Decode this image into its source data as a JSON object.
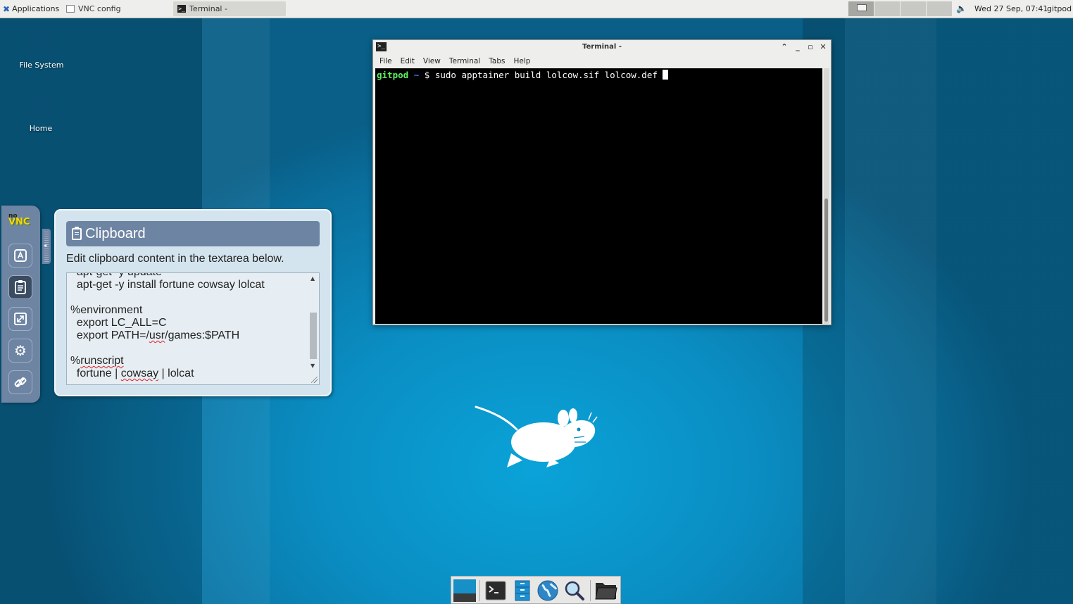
{
  "top_panel": {
    "applications_label": "Applications",
    "tasks": [
      {
        "label": "VNC config"
      },
      {
        "label": "Terminal -"
      }
    ],
    "clock": "Wed 27 Sep, 07:41",
    "user": "gitpod"
  },
  "desktop_icons": [
    {
      "label": "File System",
      "icon": "drive-icon"
    },
    {
      "label": "Home",
      "icon": "home-icon"
    }
  ],
  "terminal": {
    "title": "Terminal -",
    "menu": [
      "File",
      "Edit",
      "View",
      "Terminal",
      "Tabs",
      "Help"
    ],
    "prompt_user": "gitpod",
    "prompt_dir": "~",
    "prompt_symbol": "$",
    "command": "sudo apptainer build lolcow.sif lolcow.def"
  },
  "novnc": {
    "logo_top": "no",
    "logo_bottom": "VNC",
    "buttons": [
      "extra-keys",
      "clipboard",
      "fullscreen",
      "settings",
      "disconnect"
    ]
  },
  "clipboard": {
    "title": "Clipboard",
    "description": "Edit clipboard content in the textarea below.",
    "lines": [
      "  apt-get -y update",
      "  apt-get -y install fortune cowsay lolcat",
      "",
      "%environment",
      "  export LC_ALL=C",
      "  export PATH=/usr/games:$PATH",
      "",
      "%runscript",
      "  fortune | cowsay | lolcat"
    ]
  },
  "colors": {
    "desktop": "#0a8dc2",
    "novnc_bar": "#6e84a3",
    "clipboard_panel": "#d4e4ee",
    "terminal_bg": "#000000",
    "prompt_green": "#5ef25e"
  }
}
